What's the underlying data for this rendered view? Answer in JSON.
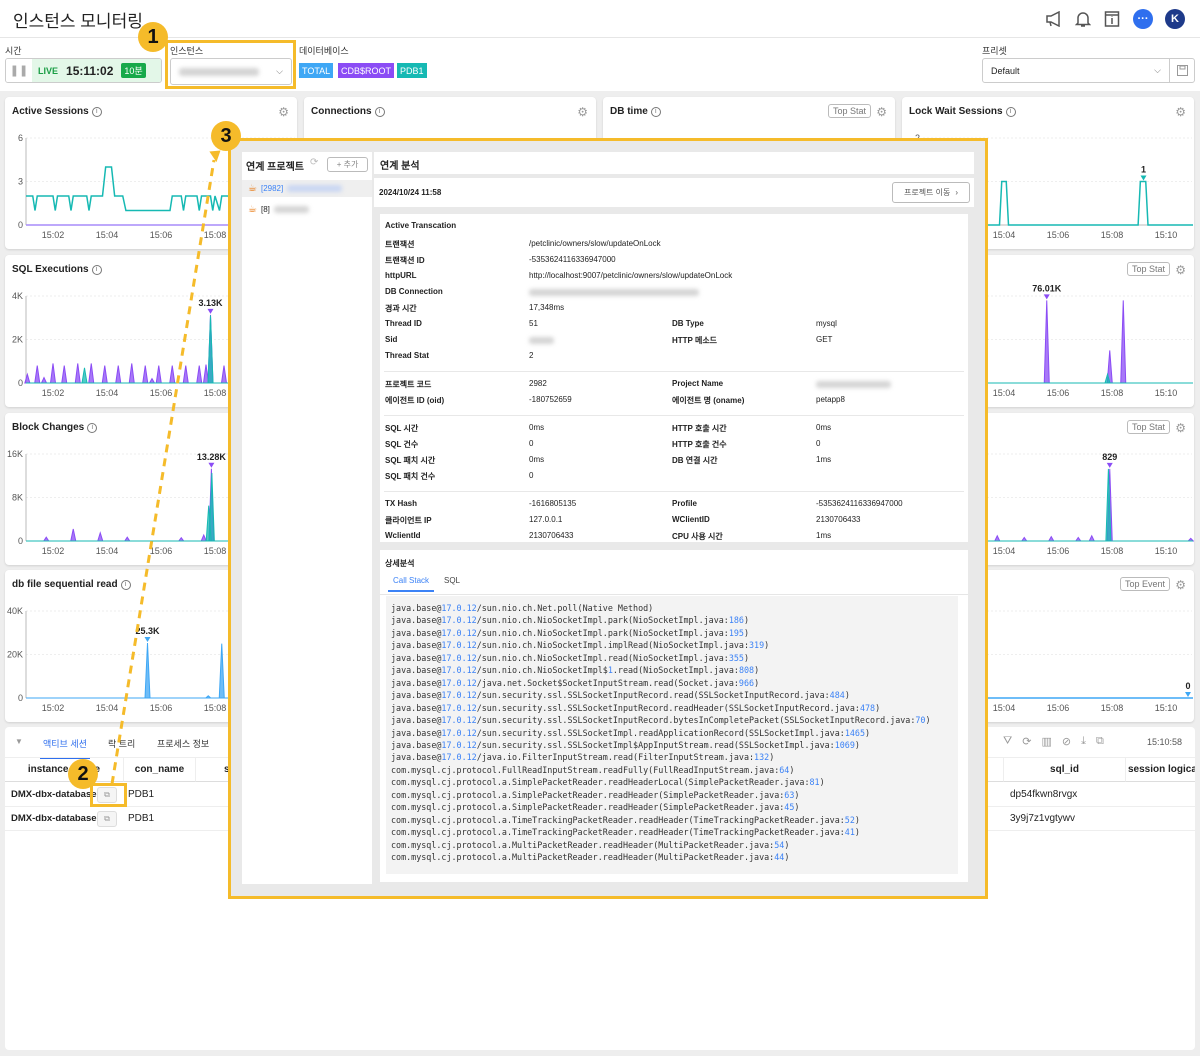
{
  "header": {
    "title": "인스턴스 모니터링",
    "icons": [
      "megaphone-icon",
      "bell-icon",
      "info-book-icon",
      "chat-icon",
      "avatar"
    ],
    "avatar_letter": "K"
  },
  "toolbar": {
    "time_label": "시간",
    "live": "LIVE",
    "clock": "15:11:02",
    "range": "10분",
    "instance_label": "인스턴스",
    "database_label": "데이터베이스",
    "databases": [
      {
        "name": "TOTAL",
        "color": "#3ea7f5"
      },
      {
        "name": "CDB$ROOT",
        "color": "#8b4cf5"
      },
      {
        "name": "PDB1",
        "color": "#16b9b3"
      }
    ],
    "preset_label": "프리셋",
    "preset_value": "Default"
  },
  "colors": {
    "accent": "#3b82f6",
    "highlight": "#f5bb2a",
    "teal": "#16b9b3",
    "purple": "#8b4cf5",
    "blue": "#3ea7f5"
  },
  "cards": [
    {
      "title": "Active Sessions",
      "button": ""
    },
    {
      "title": "Connections",
      "button": ""
    },
    {
      "title": "DB time",
      "button": "Top Stat"
    },
    {
      "title": "Lock Wait Sessions",
      "button": ""
    },
    {
      "title": "SQL Executions",
      "button": ""
    },
    {
      "title": "",
      "button": "Top Stat"
    },
    {
      "title": "Block Changes",
      "button": ""
    },
    {
      "title": "",
      "button": "Top Stat"
    },
    {
      "title": "db file sequential read",
      "button": ""
    },
    {
      "title": "",
      "button": "Top Event"
    }
  ],
  "chart_data": [
    {
      "card": 0,
      "type": "line",
      "ylim": [
        0,
        6
      ],
      "yticks": [
        "0",
        "3",
        "6"
      ],
      "xticks": [
        "15:02",
        "15:04",
        "15:06",
        "15:08",
        "15:10"
      ],
      "series": [
        {
          "color": "#16b9b3",
          "points": [
            [
              "15:01:00",
              2
            ],
            [
              "15:01:15",
              2
            ],
            [
              "15:01:20",
              1
            ],
            [
              "15:01:25",
              2
            ],
            [
              "15:02:00",
              2
            ],
            [
              "15:02:05",
              1
            ],
            [
              "15:02:10",
              2
            ],
            [
              "15:02:35",
              2
            ],
            [
              "15:02:40",
              1
            ],
            [
              "15:02:45",
              2
            ],
            [
              "15:03:15",
              2
            ],
            [
              "15:03:20",
              1
            ],
            [
              "15:03:25",
              2
            ],
            [
              "15:03:50",
              2
            ],
            [
              "15:03:57",
              4
            ],
            [
              "15:04:10",
              4
            ],
            [
              "15:04:17",
              2
            ],
            [
              "15:04:35",
              2
            ],
            [
              "15:04:42",
              1
            ],
            [
              "15:06:20",
              1
            ],
            [
              "15:06:25",
              2
            ],
            [
              "15:06:45",
              2
            ],
            [
              "15:06:50",
              1
            ],
            [
              "15:06:55",
              2
            ],
            [
              "15:07:20",
              2
            ],
            [
              "15:07:25",
              1
            ],
            [
              "15:07:30",
              2
            ],
            [
              "15:07:50",
              2
            ],
            [
              "15:07:55",
              1
            ],
            [
              "15:08:00",
              2
            ],
            [
              "15:08:10",
              1
            ],
            [
              "15:08:15",
              2
            ],
            [
              "15:08:30",
              2
            ],
            [
              "15:08:35",
              1
            ],
            [
              "15:08:40",
              2
            ],
            [
              "15:09:30",
              2
            ],
            [
              "15:09:35",
              1
            ],
            [
              "15:09:40",
              2
            ],
            [
              "15:10:30",
              2
            ],
            [
              "15:10:35",
              1
            ],
            [
              "15:10:40",
              2
            ],
            [
              "15:11:00",
              2
            ]
          ]
        },
        {
          "color": "#a78bfa",
          "points": [
            [
              "15:01:00",
              0
            ],
            [
              "15:11:00",
              0
            ]
          ]
        }
      ]
    },
    {
      "card": 3,
      "type": "line",
      "ylim": [
        0,
        2
      ],
      "yticks": [
        "0",
        "1",
        "2"
      ],
      "xticks": [
        "15:02",
        "15:04",
        "15:06",
        "15:08",
        "15:10"
      ],
      "peak": {
        "x": "15:09:10",
        "y": 1,
        "label": "1",
        "color": "#16b9b3"
      },
      "series": [
        {
          "color": "#16b9b3",
          "points": [
            [
              "15:01:00",
              0
            ],
            [
              "15:03:50",
              0
            ],
            [
              "15:03:55",
              1
            ],
            [
              "15:04:05",
              1
            ],
            [
              "15:04:10",
              0
            ],
            [
              "15:08:58",
              0
            ],
            [
              "15:09:03",
              1
            ],
            [
              "15:09:15",
              1
            ],
            [
              "15:09:20",
              0
            ],
            [
              "15:11:00",
              0
            ]
          ]
        }
      ]
    },
    {
      "card": 4,
      "type": "spikes",
      "ylim": [
        0,
        4000
      ],
      "yticks": [
        "0",
        "2K",
        "4K"
      ],
      "xticks": [
        "15:02",
        "15:04",
        "15:06",
        "15:08",
        "15:10"
      ],
      "peak": {
        "x": "15:07:50",
        "y": 3130,
        "label": "3.13K",
        "color": "#8b4cf5"
      },
      "series": [
        {
          "color": "#8b4cf5",
          "peaks": [
            [
              "15:01:03",
              400
            ],
            [
              "15:01:25",
              800
            ],
            [
              "15:01:40",
              250
            ],
            [
              "15:02:00",
              900
            ],
            [
              "15:02:25",
              800
            ],
            [
              "15:02:55",
              900
            ],
            [
              "15:03:25",
              900
            ],
            [
              "15:03:55",
              800
            ],
            [
              "15:04:25",
              800
            ],
            [
              "15:04:55",
              900
            ],
            [
              "15:05:25",
              800
            ],
            [
              "15:05:40",
              200
            ],
            [
              "15:05:55",
              800
            ],
            [
              "15:06:25",
              800
            ],
            [
              "15:06:55",
              800
            ],
            [
              "15:07:25",
              800
            ],
            [
              "15:07:40",
              850
            ],
            [
              "15:07:50",
              3130
            ],
            [
              "15:08:20",
              800
            ],
            [
              "15:08:55",
              800
            ],
            [
              "15:09:25",
              800
            ],
            [
              "15:09:55",
              800
            ],
            [
              "15:10:25",
              800
            ]
          ]
        },
        {
          "color": "#16b9b3",
          "peaks": [
            [
              "15:03:10",
              700
            ],
            [
              "15:07:50",
              3100
            ]
          ]
        }
      ]
    },
    {
      "card": 5,
      "type": "spikes",
      "ylim": [
        0,
        80000
      ],
      "yticks": [],
      "xticks": [
        "15:02",
        "15:04",
        "15:06",
        "15:08",
        "15:10"
      ],
      "peak": {
        "x": "15:05:35",
        "y": 76010,
        "label": "76.01K",
        "color": "#8b4cf5"
      },
      "series": [
        {
          "color": "#8b4cf5",
          "peaks": [
            [
              "15:05:35",
              76010
            ],
            [
              "15:07:55",
              30000
            ],
            [
              "15:08:25",
              76000
            ]
          ]
        },
        {
          "color": "#16b9b3",
          "peaks": [
            [
              "15:07:50",
              8000
            ]
          ]
        }
      ]
    },
    {
      "card": 6,
      "type": "spikes",
      "ylim": [
        0,
        16000
      ],
      "yticks": [
        "0",
        "8K",
        "16K"
      ],
      "xticks": [
        "15:02",
        "15:04",
        "15:06",
        "15:08",
        "15:10"
      ],
      "peak": {
        "x": "15:07:52",
        "y": 13280,
        "label": "13.28K",
        "color": "#8b4cf5"
      },
      "series": [
        {
          "color": "#8b4cf5",
          "peaks": [
            [
              "15:01:45",
              700
            ],
            [
              "15:02:45",
              2200
            ],
            [
              "15:03:45",
              1500
            ],
            [
              "15:04:45",
              700
            ],
            [
              "15:06:45",
              600
            ],
            [
              "15:07:35",
              1100
            ],
            [
              "15:07:52",
              13280
            ]
          ]
        },
        {
          "color": "#16b9b3",
          "peaks": [
            [
              "15:07:46",
              6500
            ],
            [
              "15:07:53",
              12500
            ]
          ]
        }
      ]
    },
    {
      "card": 7,
      "type": "spikes",
      "ylim": [
        0,
        1000
      ],
      "yticks": [],
      "xticks": [
        "15:02",
        "15:04",
        "15:06",
        "15:08",
        "15:10"
      ],
      "peak": {
        "x": "15:07:55",
        "y": 829,
        "label": "829",
        "color": "#8b4cf5"
      },
      "series": [
        {
          "color": "#8b4cf5",
          "peaks": [
            [
              "15:03:45",
              60
            ],
            [
              "15:04:45",
              40
            ],
            [
              "15:05:45",
              50
            ],
            [
              "15:06:45",
              40
            ],
            [
              "15:07:15",
              60
            ],
            [
              "15:07:55",
              829
            ],
            [
              "15:10:55",
              30
            ]
          ]
        },
        {
          "color": "#16b9b3",
          "peaks": [
            [
              "15:07:52",
              829
            ]
          ]
        }
      ]
    },
    {
      "card": 8,
      "type": "spikes",
      "ylim": [
        0,
        40000
      ],
      "yticks": [
        "0",
        "20K",
        "40K"
      ],
      "xticks": [
        "15:02",
        "15:04",
        "15:06",
        "15:08",
        "15:10"
      ],
      "peak": {
        "x": "15:05:30",
        "y": 25300,
        "label": "25.3K",
        "color": "#3ea7f5"
      },
      "series": [
        {
          "color": "#3ea7f5",
          "peaks": [
            [
              "15:05:30",
              25300
            ],
            [
              "15:07:45",
              1000
            ],
            [
              "15:08:15",
              25000
            ]
          ]
        }
      ]
    },
    {
      "card": 9,
      "type": "line",
      "ylim": [
        0,
        40000
      ],
      "yticks": [],
      "xticks": [
        "15:02",
        "15:04",
        "15:06",
        "15:08",
        "15:10"
      ],
      "peak": {
        "x": "15:11:00",
        "y": 0,
        "label": "0",
        "color": "#3ea7f5"
      },
      "series": [
        {
          "color": "#3ea7f5",
          "points": [
            [
              "15:01:00",
              0
            ],
            [
              "15:11:00",
              0
            ]
          ]
        }
      ]
    }
  ],
  "bottom": {
    "tabs": [
      "액티브 세션",
      "락 트리",
      "프로세스 정보"
    ],
    "updated": "15:10:58",
    "toolbar_icons": [
      "filter-icon",
      "refresh-icon",
      "columns-icon",
      "block-icon",
      "download-icon",
      "window-icon"
    ],
    "columns": [
      "instance_name",
      "con_name",
      "s",
      "sql_id",
      "session logica"
    ],
    "rows": [
      {
        "instance": "DMX-dbx-database",
        "con": "PDB1",
        "sql_id": "dp54fkwn8rvgx"
      },
      {
        "instance": "DMX-dbx-database",
        "con": "PDB1",
        "sql_id": "3y9j7z1vgtywv"
      }
    ]
  },
  "popup": {
    "projects_title": "연계 프로젝트",
    "add_button": "+ 추가",
    "projects": [
      {
        "code": "[2982]",
        "selected": true
      },
      {
        "code": "[8]",
        "selected": false
      }
    ],
    "analysis_title": "연계 분석",
    "date": "2024/10/24 11:58",
    "move_button": "프로젝트 이동",
    "section_title": "Active Transcation",
    "rows": [
      {
        "k": "트랜잭션",
        "v": "/petclinic/owners/slow/updateOnLock"
      },
      {
        "k": "트랜잭션 ID",
        "v": "-5353624116336947000"
      },
      {
        "k": "httpURL",
        "v": "http://localhost:9007/petclinic/owners/slow/updateOnLock"
      },
      {
        "k": "DB Connection",
        "v": "",
        "blur": true
      },
      {
        "k": "경과 시간",
        "v": "17,348ms"
      },
      {
        "k": "Thread ID",
        "v": "51",
        "k2": "DB Type",
        "v2": "mysql"
      },
      {
        "k": "Sid",
        "v": "",
        "blur": true,
        "k2": "HTTP 메소드",
        "v2": "GET"
      },
      {
        "k": "Thread Stat",
        "v": "2"
      },
      {
        "divider": true
      },
      {
        "k": "프로젝트 코드",
        "v": "2982",
        "k2": "Project Name",
        "v2": "",
        "blur2": true
      },
      {
        "k": "에이전트 ID (oid)",
        "v": "-180752659",
        "k2": "에이전트 명 (oname)",
        "v2": "petapp8"
      },
      {
        "divider": true
      },
      {
        "k": "SQL 시간",
        "v": "0ms",
        "k2": "HTTP 호출 시간",
        "v2": "0ms"
      },
      {
        "k": "SQL 건수",
        "v": "0",
        "k2": "HTTP 호출 건수",
        "v2": "0"
      },
      {
        "k": "SQL 패치 시간",
        "v": "0ms",
        "k2": "DB 연결 시간",
        "v2": "1ms"
      },
      {
        "k": "SQL 패치 건수",
        "v": "0"
      },
      {
        "divider": true
      },
      {
        "k": "TX Hash",
        "v": "-1616805135",
        "k2": "Profile",
        "v2": "-5353624116336947000"
      },
      {
        "k": "클라이언트 IP",
        "v": "127.0.0.1",
        "k2": "WClientID",
        "v2": "2130706433"
      },
      {
        "k": "WclientId",
        "v": "2130706433",
        "k2": "CPU 사용 시간",
        "v2": "1ms"
      }
    ],
    "detail_title": "상세분석",
    "detail_tabs": [
      "Call Stack",
      "SQL"
    ],
    "callstack": [
      "java.base@17.0.12/sun.nio.ch.Net.poll(Native Method)",
      "java.base@17.0.12/sun.nio.ch.NioSocketImpl.park(NioSocketImpl.java:186)",
      "java.base@17.0.12/sun.nio.ch.NioSocketImpl.park(NioSocketImpl.java:195)",
      "java.base@17.0.12/sun.nio.ch.NioSocketImpl.implRead(NioSocketImpl.java:319)",
      "java.base@17.0.12/sun.nio.ch.NioSocketImpl.read(NioSocketImpl.java:355)",
      "java.base@17.0.12/sun.nio.ch.NioSocketImpl$1.read(NioSocketImpl.java:808)",
      "java.base@17.0.12/java.net.Socket$SocketInputStream.read(Socket.java:966)",
      "java.base@17.0.12/sun.security.ssl.SSLSocketInputRecord.read(SSLSocketInputRecord.java:484)",
      "java.base@17.0.12/sun.security.ssl.SSLSocketInputRecord.readHeader(SSLSocketInputRecord.java:478)",
      "java.base@17.0.12/sun.security.ssl.SSLSocketInputRecord.bytesInCompletePacket(SSLSocketInputRecord.java:70)",
      "java.base@17.0.12/sun.security.ssl.SSLSocketImpl.readApplicationRecord(SSLSocketImpl.java:1465)",
      "java.base@17.0.12/sun.security.ssl.SSLSocketImpl$AppInputStream.read(SSLSocketImpl.java:1069)",
      "java.base@17.0.12/java.io.FilterInputStream.read(FilterInputStream.java:132)",
      "com.mysql.cj.protocol.FullReadInputStream.readFully(FullReadInputStream.java:64)",
      "com.mysql.cj.protocol.a.SimplePacketReader.readHeaderLocal(SimplePacketReader.java:81)",
      "com.mysql.cj.protocol.a.SimplePacketReader.readHeader(SimplePacketReader.java:63)",
      "com.mysql.cj.protocol.a.SimplePacketReader.readHeader(SimplePacketReader.java:45)",
      "com.mysql.cj.protocol.a.TimeTrackingPacketReader.readHeader(TimeTrackingPacketReader.java:52)",
      "com.mysql.cj.protocol.a.TimeTrackingPacketReader.readHeader(TimeTrackingPacketReader.java:41)",
      "com.mysql.cj.protocol.a.MultiPacketReader.readHeader(MultiPacketReader.java:54)",
      "com.mysql.cj.protocol.a.MultiPacketReader.readHeader(MultiPacketReader.java:44)"
    ]
  },
  "annotations": [
    "1",
    "2",
    "3"
  ]
}
